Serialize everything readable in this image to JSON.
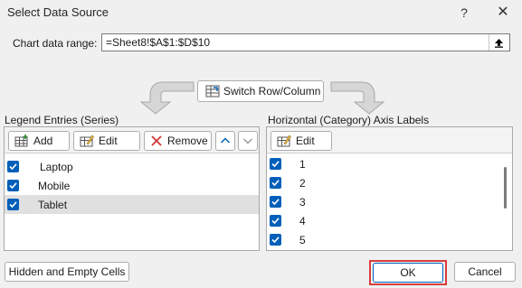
{
  "window": {
    "title": "Select Data Source",
    "help": "?",
    "close": "✕"
  },
  "range": {
    "label": "Chart data range:",
    "value": "=Sheet8!$A$1:$D$10"
  },
  "switch_button": "Switch Row/Column",
  "legend": {
    "label": "Legend Entries (Series)",
    "add": "Add",
    "edit": "Edit",
    "remove": "Remove",
    "items": [
      {
        "label": "Laptop",
        "checked": true
      },
      {
        "label": "Mobile",
        "checked": true
      },
      {
        "label": "Tablet",
        "checked": true,
        "selected": true
      }
    ]
  },
  "axis": {
    "label": "Horizontal (Category) Axis Labels",
    "edit": "Edit",
    "items": [
      "1",
      "2",
      "3",
      "4",
      "5"
    ]
  },
  "buttons": {
    "hidden_empty": "Hidden and Empty Cells",
    "ok": "OK",
    "cancel": "Cancel"
  },
  "colors": {
    "accent": "#005fb8",
    "highlight_border": "#d93b3b",
    "remove_x": "#d13438"
  }
}
